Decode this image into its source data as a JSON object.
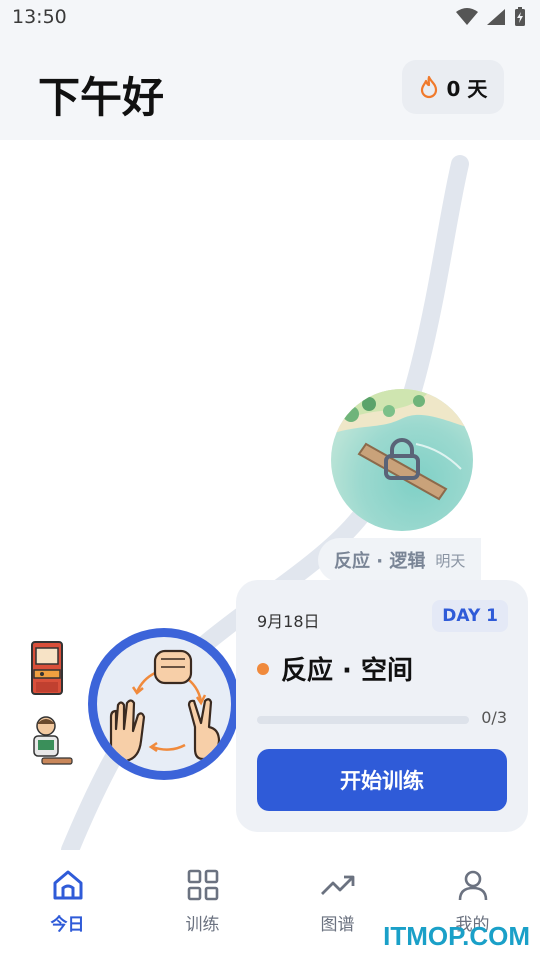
{
  "status_bar": {
    "time": "13:50"
  },
  "header": {
    "greeting": "下午好",
    "streak_value": "0 天"
  },
  "map": {
    "next_session": {
      "title": "反应 · 逻辑",
      "when": "明天"
    }
  },
  "card": {
    "date": "9月18日",
    "day_badge": "DAY 1",
    "title": "反应 · 空间",
    "progress_text": "0/3",
    "progress": {
      "done": 0,
      "total": 3
    },
    "start_button": "开始训练"
  },
  "bottom_nav": {
    "items": [
      {
        "label": "今日",
        "icon": "home-icon",
        "active": true
      },
      {
        "label": "训练",
        "icon": "grid-icon",
        "active": false
      },
      {
        "label": "图谱",
        "icon": "trend-icon",
        "active": false
      },
      {
        "label": "我的",
        "icon": "user-icon",
        "active": false
      }
    ]
  },
  "watermark": "ITMOP.COM",
  "colors": {
    "accent": "#2f5bd8",
    "dot": "#f08a3c",
    "path": "#e1e6ee"
  }
}
